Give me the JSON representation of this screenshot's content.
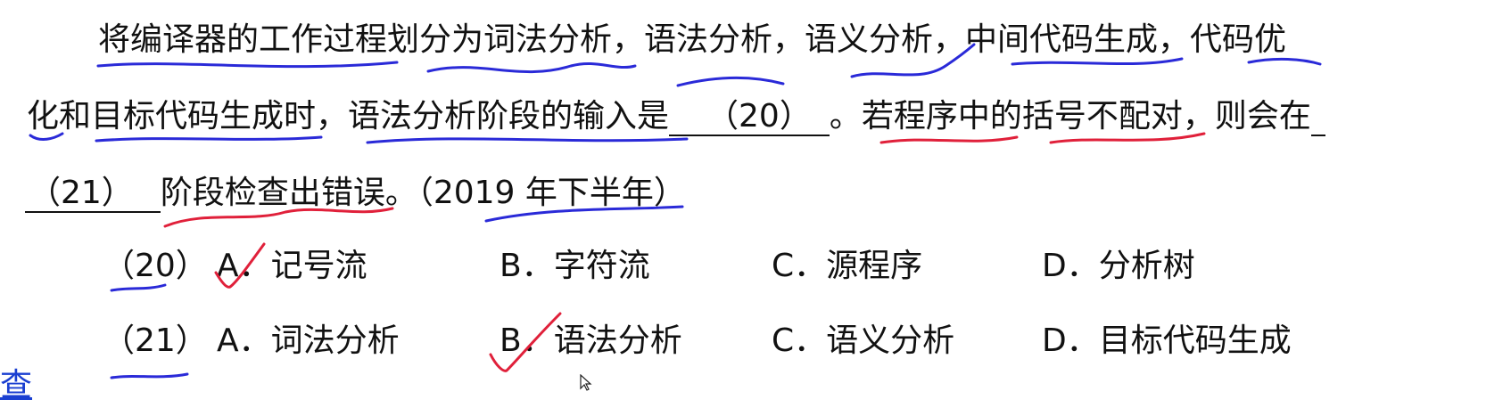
{
  "question": {
    "line1": "将编译器的工作过程划分为词法分析，语法分析，语义分析，中间代码生成，代码优",
    "line2_a": "化和目标代码生成时，语法分析阶段的输入是",
    "blank20": "（20）",
    "line2_b": "。若程序中的括号不配对，则会在",
    "blank21": "（21）",
    "line3_a": "阶段检查出错误。（2019 年下半年）"
  },
  "q20": {
    "number": "（20）",
    "options": [
      {
        "letter": "A．",
        "text": "记号流"
      },
      {
        "letter": "B．",
        "text": "字符流"
      },
      {
        "letter": "C．",
        "text": "源程序"
      },
      {
        "letter": "D．",
        "text": "分析树"
      }
    ]
  },
  "q21": {
    "number": "（21）",
    "options": [
      {
        "letter": "A．",
        "text": "词法分析"
      },
      {
        "letter": "B．",
        "text": "语法分析"
      },
      {
        "letter": "C．",
        "text": "语义分析"
      },
      {
        "letter": "D．",
        "text": "目标代码生成"
      }
    ]
  },
  "side_link": "查",
  "colors": {
    "ink_blue": "#2a2ad8",
    "ink_red": "#e0203a",
    "text": "#111111"
  }
}
